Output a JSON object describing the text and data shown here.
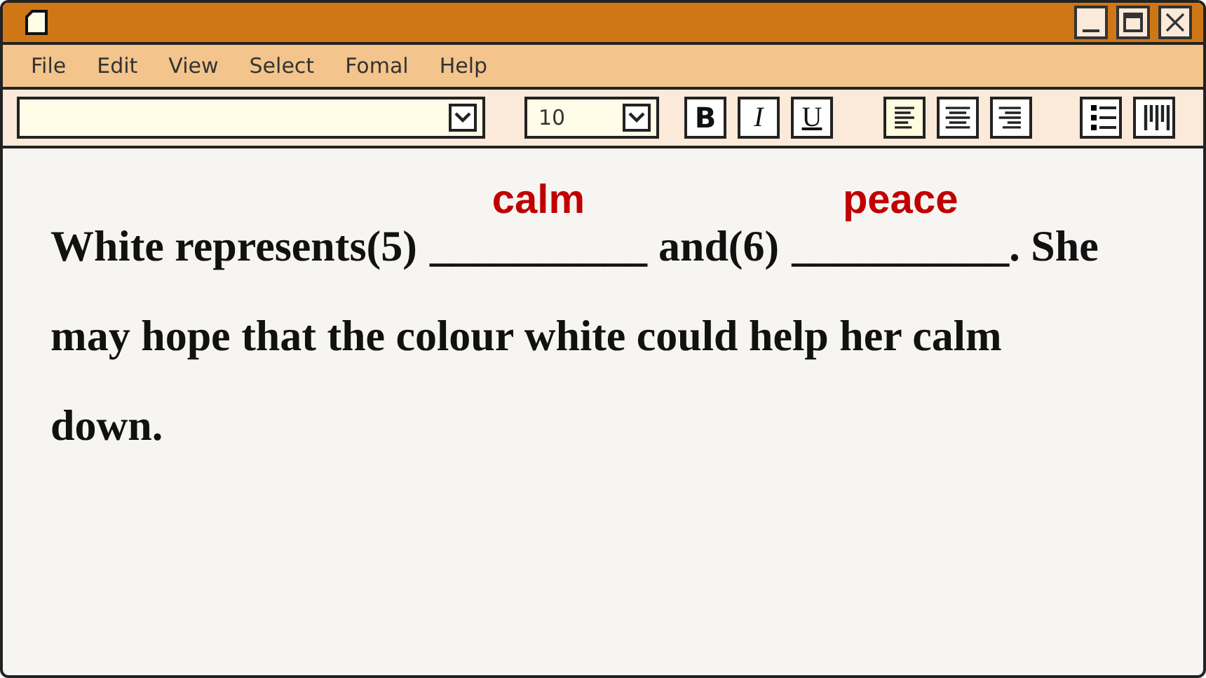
{
  "menu": [
    "File",
    "Edit",
    "View",
    "Select",
    "Fomal",
    "Help"
  ],
  "toolbar": {
    "font_size": "10",
    "format_buttons": [
      "B",
      "I",
      "U"
    ],
    "align": [
      {
        "kind": "left",
        "selected": true
      },
      {
        "kind": "center",
        "selected": false
      },
      {
        "kind": "right",
        "selected": false
      }
    ]
  },
  "passage": [
    [
      {
        "kind": "text",
        "text": "White represents(5)"
      },
      {
        "kind": "blank",
        "line": "__________",
        "answer": "calm"
      },
      {
        "kind": "text",
        "text": "and(6)"
      },
      {
        "kind": "blank",
        "line": "__________",
        "answer": "peace"
      },
      {
        "kind": "text",
        "text": ". She"
      }
    ],
    [
      {
        "kind": "text",
        "text": "may hope that the colour white could help her calm"
      }
    ],
    [
      {
        "kind": "text",
        "text": "down."
      }
    ]
  ]
}
